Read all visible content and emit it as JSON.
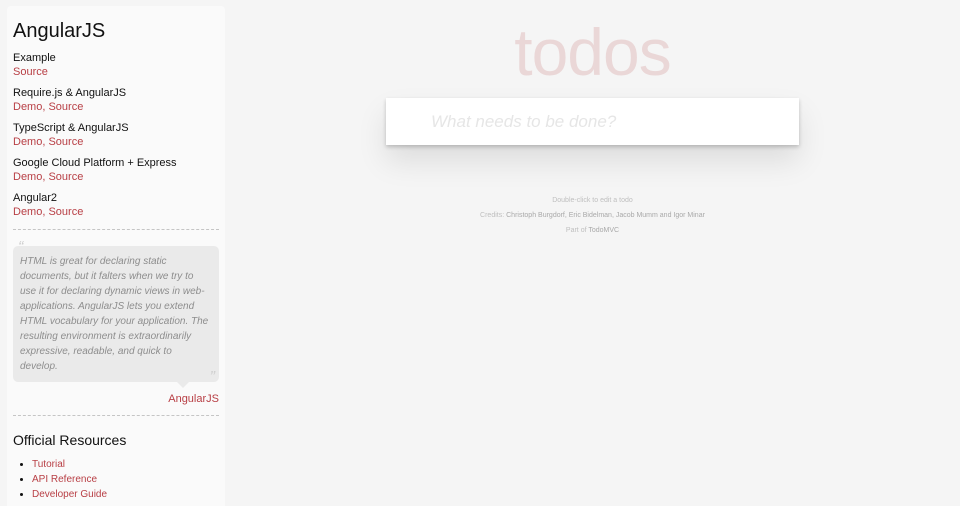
{
  "sidebar": {
    "title": "AngularJS",
    "examples": [
      {
        "name": "Example",
        "demo": null,
        "source": "Source"
      },
      {
        "name": "Require.js & AngularJS",
        "demo": "Demo",
        "source": "Source"
      },
      {
        "name": "TypeScript & AngularJS",
        "demo": "Demo",
        "source": "Source"
      },
      {
        "name": "Google Cloud Platform + Express",
        "demo": "Demo",
        "source": "Source"
      },
      {
        "name": "Angular2",
        "demo": "Demo",
        "source": "Source"
      }
    ],
    "separator": ",",
    "quote": {
      "open": "“",
      "close": "”",
      "text": "HTML is great for declaring static documents, but it falters when we try to use it for declaring dynamic views in web-applications. AngularJS lets you extend HTML vocabulary for your application. The resulting environment is extraordinarily expressive, readable, and quick to develop.",
      "attribution": "AngularJS"
    },
    "resources": {
      "title": "Official Resources",
      "items": [
        "Tutorial",
        "API Reference",
        "Developer Guide"
      ]
    }
  },
  "app": {
    "title": "todos",
    "new_todo_placeholder": "What needs to be done?",
    "new_todo_value": ""
  },
  "info": {
    "hint": "Double-click to edit a todo",
    "credits_prefix": "Credits:",
    "credits_names": "Christoph Burgdorf, Eric Bidelman, Jacob Mumm and Igor Minar",
    "part_of_prefix": "Part of",
    "part_of_link": "TodoMVC"
  },
  "colors": {
    "accent": "#b83f45",
    "title": "#efd5d5",
    "background": "#f5f5f5"
  }
}
